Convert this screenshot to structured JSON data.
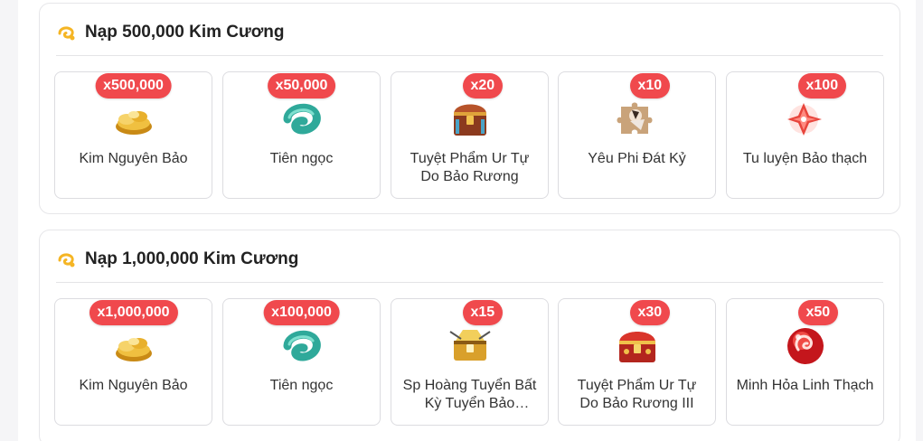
{
  "sections": [
    {
      "title": "Nạp 500,000 Kim Cương",
      "items": [
        {
          "name": "Kim Nguyên Bảo",
          "qty": "x500,000",
          "icon": "gold-ingot-icon"
        },
        {
          "name": "Tiên ngọc",
          "qty": "x50,000",
          "icon": "jade-icon"
        },
        {
          "name": "Tuyệt Phẩm Ur Tự Do Bảo Rương",
          "qty": "x20",
          "icon": "treasure-chest-icon"
        },
        {
          "name": "Yêu Phi Đát Kỷ",
          "qty": "x10",
          "icon": "puzzle-piece-icon"
        },
        {
          "name": "Tu luyện Bảo thạch",
          "qty": "x100",
          "icon": "red-gem-icon"
        }
      ]
    },
    {
      "title": "Nạp 1,000,000 Kim Cương",
      "items": [
        {
          "name": "Kim Nguyên Bảo",
          "qty": "x1,000,000",
          "icon": "gold-ingot-icon"
        },
        {
          "name": "Tiên ngọc",
          "qty": "x100,000",
          "icon": "jade-icon"
        },
        {
          "name": "Sp Hoàng Tuyển Bất Kỳ Tuyển Bảo Rương",
          "qty": "x15",
          "icon": "golden-chest-icon"
        },
        {
          "name": "Tuyệt Phẩm Ur Tự Do Bảo Rương III",
          "qty": "x30",
          "icon": "red-chest-icon"
        },
        {
          "name": "Minh Hỏa Linh Thạch",
          "qty": "x50",
          "icon": "fire-orb-icon"
        }
      ]
    }
  ],
  "colors": {
    "badge": "#f0494d",
    "accent": "#f5b524"
  }
}
